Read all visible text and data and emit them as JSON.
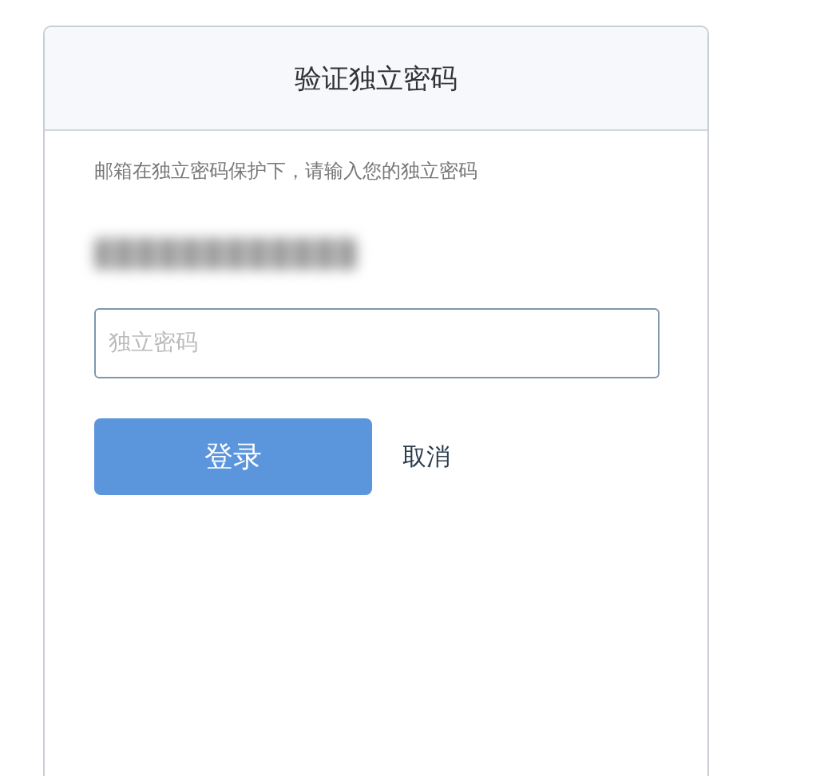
{
  "dialog": {
    "title": "验证独立密码",
    "description": "邮箱在独立密码保护下，请输入您的独立密码",
    "password_field": {
      "placeholder": "独立密码"
    },
    "buttons": [
      {
        "kind": "primary",
        "label": "登录"
      },
      {
        "kind": "link",
        "label": "取消"
      }
    ]
  }
}
